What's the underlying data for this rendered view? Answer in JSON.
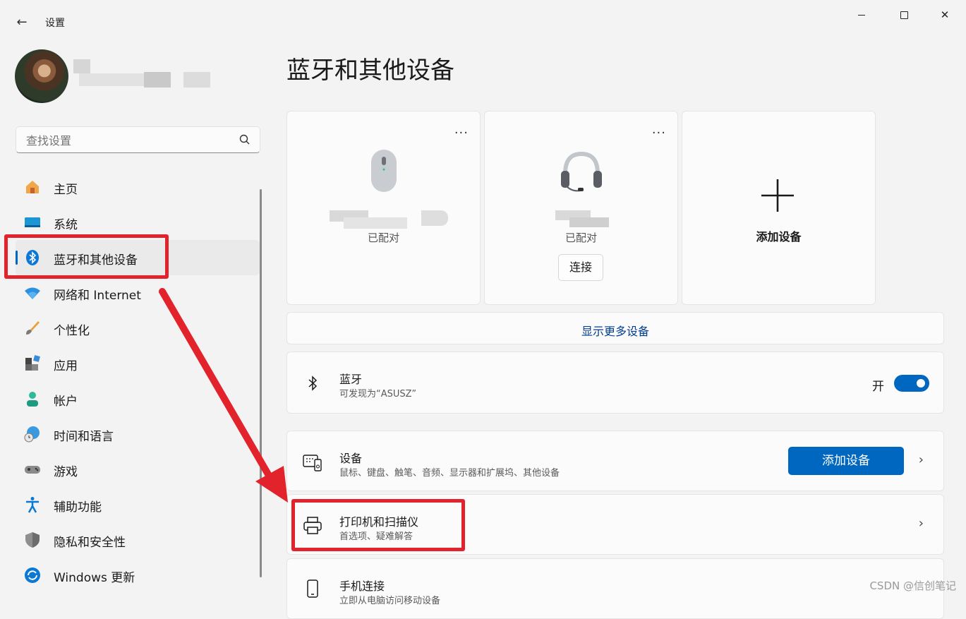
{
  "window": {
    "title": "设置",
    "back_glyph": "←",
    "close_glyph": "✕"
  },
  "search": {
    "placeholder": "查找设置"
  },
  "sidebar": {
    "items": [
      {
        "label": "主页",
        "icon": "home-icon"
      },
      {
        "label": "系统",
        "icon": "system-icon"
      },
      {
        "label": "蓝牙和其他设备",
        "icon": "bluetooth-icon",
        "active": true
      },
      {
        "label": "网络和 Internet",
        "icon": "wifi-icon"
      },
      {
        "label": "个性化",
        "icon": "brush-icon"
      },
      {
        "label": "应用",
        "icon": "apps-icon"
      },
      {
        "label": "帐户",
        "icon": "account-icon"
      },
      {
        "label": "时间和语言",
        "icon": "globe-clock-icon"
      },
      {
        "label": "游戏",
        "icon": "gamepad-icon"
      },
      {
        "label": "辅助功能",
        "icon": "accessibility-icon"
      },
      {
        "label": "隐私和安全性",
        "icon": "shield-icon"
      },
      {
        "label": "Windows 更新",
        "icon": "update-icon"
      }
    ]
  },
  "main": {
    "title": "蓝牙和其他设备",
    "devices": [
      {
        "status": "已配对",
        "icon": "mouse-icon"
      },
      {
        "status": "已配对",
        "icon": "headset-icon",
        "action": "连接"
      },
      {
        "label": "添加设备",
        "icon": "plus-icon"
      }
    ],
    "more_glyph": "···",
    "show_more": "显示更多设备",
    "bluetooth": {
      "title": "蓝牙",
      "subtitle": "可发现为“ASUSZ”",
      "state_label": "开",
      "on": true
    },
    "devices_row": {
      "title": "设备",
      "subtitle": "鼠标、键盘、触笔、音频、显示器和扩展坞、其他设备",
      "button": "添加设备"
    },
    "printers_row": {
      "title": "打印机和扫描仪",
      "subtitle": "首选项、疑难解答"
    },
    "phone_row": {
      "title": "手机连接",
      "subtitle": "立即从电脑访问移动设备"
    },
    "chevron_glyph": "›"
  },
  "watermark": "CSDN @信创笔记",
  "colors": {
    "accent": "#0067c0",
    "annotation": "#e3232c"
  }
}
